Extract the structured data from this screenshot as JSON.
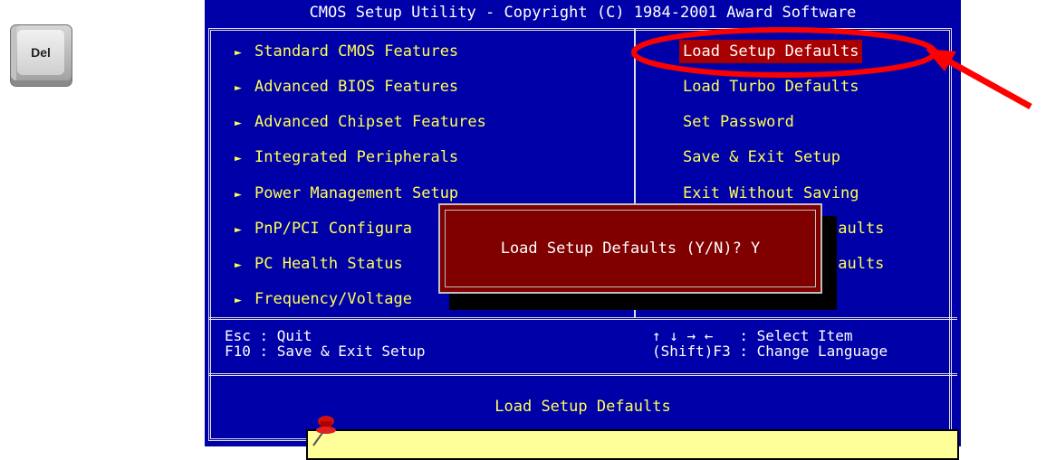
{
  "key": {
    "label": "Del"
  },
  "bios": {
    "title": "CMOS Setup Utility - Copyright (C) 1984-2001 Award Software",
    "left_menu": [
      "Standard CMOS Features",
      "Advanced BIOS Features",
      "Advanced Chipset Features",
      "Integrated Peripherals",
      "Power Management Setup",
      "PnP/PCI Configura",
      "PC Health Status",
      "Frequency/Voltage"
    ],
    "right_menu": [
      "Load Setup Defaults",
      "Load Turbo Defaults",
      "Set Password",
      "Save & Exit Setup",
      "Exit Without Saving",
      "faults",
      "faults"
    ],
    "help": {
      "esc": "Esc : Quit",
      "f10": "F10 : Save & Exit Setup",
      "arrows": "↑ ↓ → ←   : Select Item",
      "shift_f3": "(Shift)F3 : Change Language"
    },
    "status_text": "Load Setup Defaults",
    "dialog_text": "Load Setup Defaults (Y/N)? Y"
  },
  "colors": {
    "bios_bg": "#0000a8",
    "menu_text": "#ffff54",
    "highlight": "#a80000",
    "dialog_bg": "#800000",
    "annotation": "#ff0000"
  }
}
